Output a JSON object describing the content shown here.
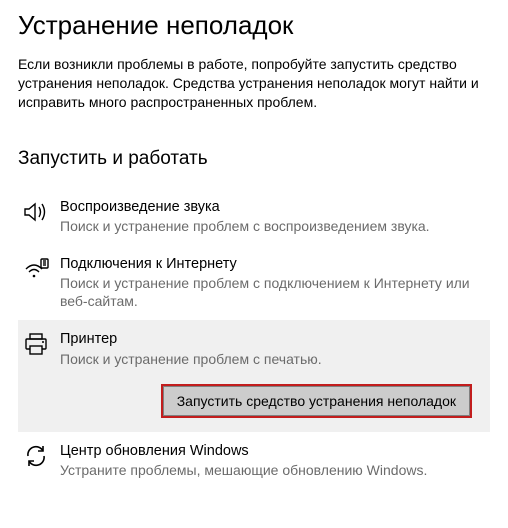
{
  "page_title": "Устранение неполадок",
  "intro": "Если возникли проблемы в работе, попробуйте запустить средство устранения неполадок. Средства устранения неполадок могут найти и исправить много распространенных проблем.",
  "section_title": "Запустить и работать",
  "items": [
    {
      "icon": "sound-icon",
      "title": "Воспроизведение звука",
      "desc": "Поиск и устранение проблем с воспроизведением звука."
    },
    {
      "icon": "wifi-icon",
      "title": "Подключения к Интернету",
      "desc": "Поиск и устранение проблем с подключением к Интернету или веб-сайтам."
    },
    {
      "icon": "printer-icon",
      "title": "Принтер",
      "desc": "Поиск и устранение проблем с печатью."
    },
    {
      "icon": "update-icon",
      "title": "Центр обновления Windows",
      "desc": "Устраните проблемы, мешающие обновлению Windows."
    }
  ],
  "run_button_label": "Запустить средство устранения неполадок"
}
